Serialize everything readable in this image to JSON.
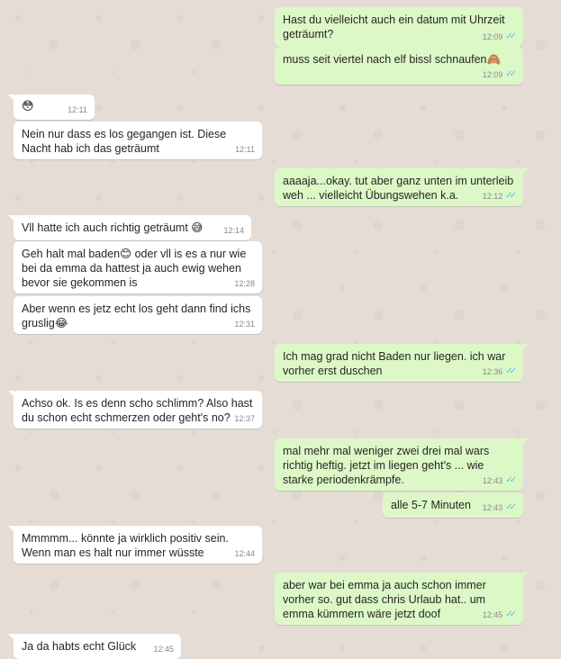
{
  "messages": [
    {
      "dir": "out",
      "text": "Hast du vielleicht auch ein datum mit Uhrzeit geträumt?",
      "time": "12:09"
    },
    {
      "dir": "out",
      "text": "muss seit viertel nach elf bissl schnaufen🙈",
      "time": "12:09"
    },
    {
      "dir": "in",
      "text": "😳",
      "time": "12:11"
    },
    {
      "dir": "in",
      "text": "Nein nur dass es los gegangen ist. Diese Nacht hab ich das geträumt",
      "time": "12:11"
    },
    {
      "dir": "out",
      "text": "aaaaja...okay. tut aber ganz unten im unterleib weh ... vielleicht Übungswehen k.a.",
      "time": "12:12"
    },
    {
      "dir": "in",
      "text": "Vll hatte ich auch richtig geträumt 😅",
      "time": "12:14"
    },
    {
      "dir": "in",
      "text": "Geh halt mal baden😊 oder vll is es a nur wie bei da emma da hattest ja auch ewig wehen bevor sie gekommen is",
      "time": "12:28"
    },
    {
      "dir": "in",
      "text": "Aber wenn es jetz echt los geht dann find ichs gruslig😂",
      "time": "12:31"
    },
    {
      "dir": "out",
      "text": "Ich mag grad nicht Baden nur liegen. ich war vorher erst duschen",
      "time": "12:36"
    },
    {
      "dir": "in",
      "text": "Achso ok. Is es denn scho schlimm?  Also hast du schon echt schmerzen oder geht's no?",
      "time": "12:37"
    },
    {
      "dir": "out",
      "text": "mal mehr mal weniger zwei drei mal wars richtig heftig. jetzt im liegen geht's ... wie starke periodenkrämpfe.",
      "time": "12:43"
    },
    {
      "dir": "out",
      "text": "alle 5-7 Minuten",
      "time": "12:43"
    },
    {
      "dir": "in",
      "text": "Mmmmm... könnte ja wirklich positiv sein. Wenn man es halt nur immer wüsste",
      "time": "12:44"
    },
    {
      "dir": "out",
      "text": "aber war bei emma ja auch schon immer vorher so. gut dass chris Urlaub hat.. um emma kümmern wäre jetzt doof",
      "time": "12:45"
    },
    {
      "dir": "in",
      "text": "Ja da habts echt Glück",
      "time": "12:45"
    }
  ],
  "read_tick_icon": "double-check-icon",
  "colors": {
    "incoming": "#ffffff",
    "outgoing": "#dcf8c6",
    "background": "#e5ddd5",
    "ticks": "#4fc3f7"
  }
}
